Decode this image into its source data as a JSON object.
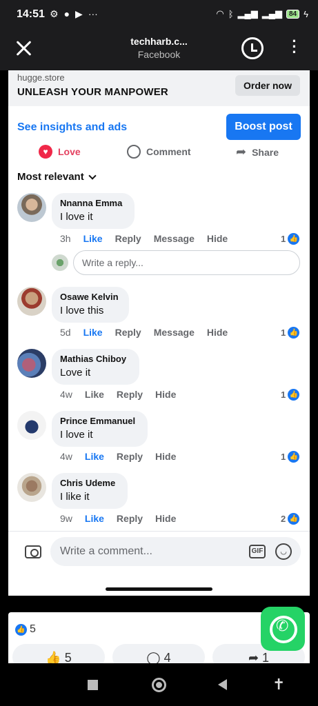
{
  "status_bar": {
    "time": "14:51",
    "battery": "84"
  },
  "header": {
    "title": "techharb.c...",
    "subtitle": "Facebook"
  },
  "ad": {
    "domain": "hugge.store",
    "title": "UNLEASH YOUR MANPOWER",
    "cta": "Order now"
  },
  "post_tools": {
    "insights": "See insights and ads",
    "boost": "Boost post"
  },
  "actions": {
    "love": "Love",
    "comment": "Comment",
    "share": "Share"
  },
  "sort": {
    "label": "Most relevant"
  },
  "comments": [
    {
      "name": "Nnanna Emma",
      "text": "I love it",
      "time": "3h",
      "like": "Like",
      "reply": "Reply",
      "message": "Message",
      "hide": "Hide",
      "likes": "1"
    },
    {
      "name": "Osawe Kelvin",
      "text": "I love this",
      "time": "5d",
      "like": "Like",
      "reply": "Reply",
      "message": "Message",
      "hide": "Hide",
      "likes": "1"
    },
    {
      "name": "Mathias Chiboy",
      "text": "Love it",
      "time": "4w",
      "like": "Like",
      "reply": "Reply",
      "hide": "Hide",
      "likes": "1"
    },
    {
      "name": "Prince Emmanuel",
      "text": "I love it",
      "time": "4w",
      "like": "Like",
      "reply": "Reply",
      "hide": "Hide",
      "likes": "1"
    },
    {
      "name": "Chris Udeme",
      "text": "I like it",
      "time": "9w",
      "like": "Like",
      "reply": "Reply",
      "hide": "Hide",
      "likes": "2"
    }
  ],
  "reply_box": {
    "placeholder": "Write a reply..."
  },
  "composer": {
    "placeholder": "Write a comment...",
    "gif": "GIF"
  },
  "lower": {
    "reaction_count": "5",
    "likes": "5",
    "comments": "4",
    "shares": "1"
  },
  "colors": {
    "accent": "#1877f2",
    "love": "#f02849",
    "whatsapp": "#25d366"
  }
}
